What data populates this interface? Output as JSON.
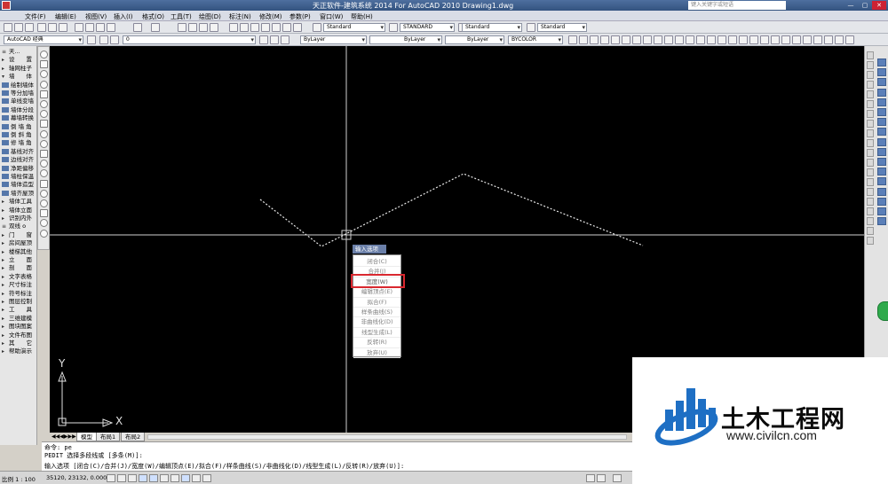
{
  "window": {
    "title": "天正软件-建筑系统 2014  For AutoCAD 2010      Drawing1.dwg",
    "search_placeholder": "键入关键字或短语"
  },
  "menu": [
    "文件(F)",
    "编辑(E)",
    "视图(V)",
    "插入(I)",
    "格式(O)",
    "工具(T)",
    "绘图(D)",
    "标注(N)",
    "修改(M)",
    "参数(P)",
    "窗口(W)",
    "帮助(H)"
  ],
  "toolbar": {
    "workspace": "AutoCAD 经典",
    "layer": "0",
    "text_style": "Standard",
    "dim_style": "STANDARD",
    "table_style": "Standard",
    "multileader_style": "Standard",
    "color": "ByLayer",
    "linetype": "ByLayer",
    "lineweight": "ByLayer",
    "plotstyle": "BYCOLOR"
  },
  "palette": {
    "items": [
      {
        "label": "天...",
        "kind": "header"
      },
      {
        "label": "设　　置",
        "kind": "group"
      },
      {
        "label": "轴网柱子",
        "kind": "group"
      },
      {
        "label": "墙　　体",
        "kind": "group-open"
      },
      {
        "label": "绘制墙体",
        "kind": "item"
      },
      {
        "label": "等分加墙",
        "kind": "item"
      },
      {
        "label": "单线变墙",
        "kind": "item"
      },
      {
        "label": "墙体分段",
        "kind": "item"
      },
      {
        "label": "幕墙转换",
        "kind": "item"
      },
      {
        "label": "倒 墙 角",
        "kind": "item"
      },
      {
        "label": "倒 斜 角",
        "kind": "item"
      },
      {
        "label": "修 墙 角",
        "kind": "item"
      },
      {
        "label": "基线对齐",
        "kind": "item"
      },
      {
        "label": "边线对齐",
        "kind": "item"
      },
      {
        "label": "净距偏移",
        "kind": "item"
      },
      {
        "label": "墙柱保温",
        "kind": "item"
      },
      {
        "label": "墙体造型",
        "kind": "item"
      },
      {
        "label": "墙齐屋顶",
        "kind": "item"
      },
      {
        "label": "墙体工具",
        "kind": "group"
      },
      {
        "label": "墙体立面",
        "kind": "group"
      },
      {
        "label": "识别内外",
        "kind": "group"
      },
      {
        "label": "双线 o",
        "kind": "header"
      },
      {
        "label": "门　　窗",
        "kind": "group"
      },
      {
        "label": "房间屋顶",
        "kind": "group"
      },
      {
        "label": "楼梯其他",
        "kind": "group"
      },
      {
        "label": "立　　面",
        "kind": "group"
      },
      {
        "label": "剖　　面",
        "kind": "group"
      },
      {
        "label": "文字表格",
        "kind": "group"
      },
      {
        "label": "尺寸标注",
        "kind": "group"
      },
      {
        "label": "符号标注",
        "kind": "group"
      },
      {
        "label": "图层控制",
        "kind": "group"
      },
      {
        "label": "工　　具",
        "kind": "group"
      },
      {
        "label": "三维建模",
        "kind": "group"
      },
      {
        "label": "图块图案",
        "kind": "group"
      },
      {
        "label": "文件布图",
        "kind": "group"
      },
      {
        "label": "其　　它",
        "kind": "group"
      },
      {
        "label": "帮助演示",
        "kind": "group"
      }
    ]
  },
  "canvas": {
    "ucs_x_label": "X",
    "ucs_y_label": "Y"
  },
  "context_menu": {
    "header": "输入选项",
    "items": [
      "闭合(C)",
      "合并(J)",
      "宽度(W)",
      "编辑顶点(E)",
      "拟合(F)",
      "样条曲线(S)",
      "非曲线化(D)",
      "线型生成(L)",
      "反转(R)",
      "放弃(U)"
    ],
    "highlighted": "宽度(W)"
  },
  "layout_tabs": [
    "模型",
    "布局1",
    "布局2"
  ],
  "command": {
    "line1": "命令: pe",
    "line2": "PEDIT 选择多段线或 [多条(M)]:",
    "line3": "输入选项 [闭合(C)/合并(J)/宽度(W)/编辑顶点(E)/拟合(F)/样条曲线(S)/非曲线化(D)/线型生成(L)/反转(R)/放弃(U)]:"
  },
  "status": {
    "scale": "比例 1 : 100",
    "coords": "35120, 23132, 0.0000"
  },
  "watermark": {
    "name": "土木工程网",
    "url": "www.civilcn.com"
  },
  "colors": {
    "canvas": "#000000",
    "highlight_box": "#d9282f",
    "watermark_blue": "#1e6fc4"
  }
}
